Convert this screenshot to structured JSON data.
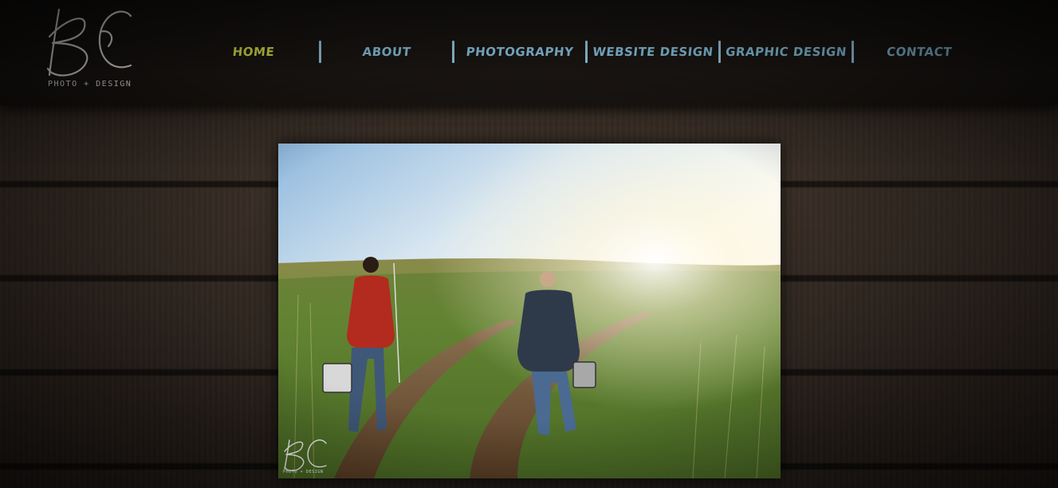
{
  "brand": {
    "logo_icon": "bc-monogram-logo",
    "tagline": "PHOTO + DESIGN"
  },
  "nav": {
    "items": [
      {
        "label": "HOME",
        "active": true
      },
      {
        "label": "ABOUT",
        "active": false
      },
      {
        "label": "PHOTOGRAPHY",
        "active": false
      },
      {
        "label": "WEBSITE DESIGN",
        "active": false
      },
      {
        "label": "GRAPHIC DESIGN",
        "active": false
      },
      {
        "label": "CONTACT",
        "active": false
      }
    ]
  },
  "hero": {
    "image_subject": "two men walking down a dirt path through a grassy field at sunset, carrying tackle boxes and fishing rods",
    "watermark_tagline": "PHOTO + DESIGN"
  },
  "colors": {
    "nav_link": "#8ecdea",
    "nav_active": "#e8f34c",
    "nav_separator": "#9fd4ec",
    "header_bg": "#1a1512",
    "wood_bg": "#3a2f27"
  }
}
